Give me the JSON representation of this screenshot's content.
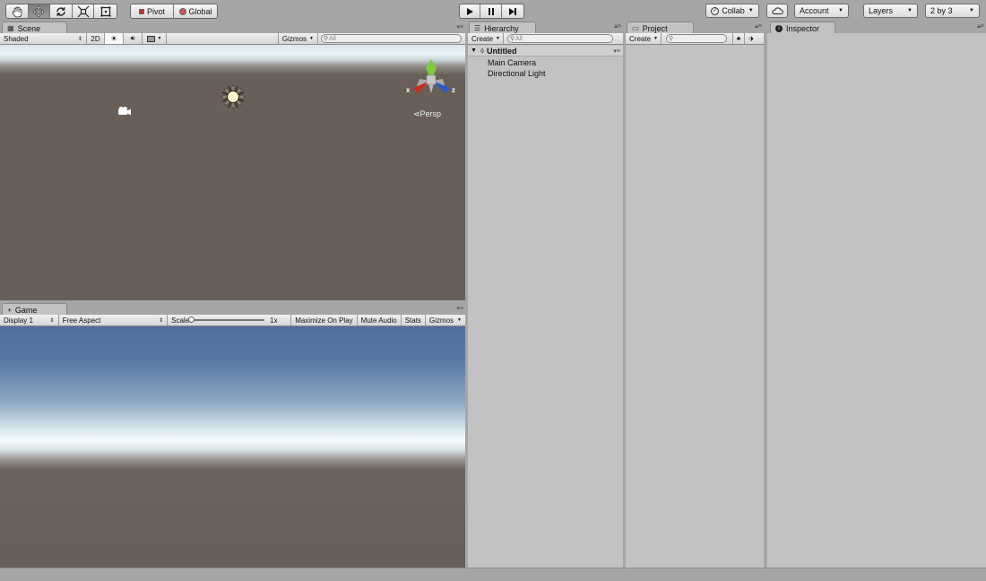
{
  "toolbar": {
    "tools": [
      "hand-tool",
      "move-tool",
      "rotate-tool",
      "scale-tool",
      "rect-tool"
    ],
    "pivot_label": "Pivot",
    "global_label": "Global",
    "collab_label": "Collab",
    "account_label": "Account",
    "layers_label": "Layers",
    "layout_label": "2 by 3"
  },
  "scene": {
    "tab_label": "Scene",
    "shading_mode": "Shaded",
    "mode_2d": "2D",
    "gizmos_label": "Gizmos",
    "search_placeholder": "All",
    "persp_label": "Persp",
    "axis_x": "x",
    "axis_z": "z"
  },
  "game": {
    "tab_label": "Game",
    "display": "Display 1",
    "aspect": "Free Aspect",
    "scale_label": "Scale",
    "scale_value": "1x",
    "maximize_label": "Maximize On Play",
    "mute_label": "Mute Audio",
    "stats_label": "Stats",
    "gizmos_label": "Gizmos"
  },
  "hierarchy": {
    "tab_label": "Hierarchy",
    "create_label": "Create",
    "search_placeholder": "All",
    "scene_name": "Untitled",
    "items": [
      "Main Camera",
      "Directional Light"
    ]
  },
  "project": {
    "tab_label": "Project",
    "create_label": "Create"
  },
  "inspector": {
    "tab_label": "Inspector"
  },
  "colors": {
    "chrome": "#a6a6a6",
    "panel": "#c2c2c2",
    "scene_ground": "#675f58",
    "sky_top": "#4d6e9c",
    "horizon": "#f0f6fa"
  }
}
